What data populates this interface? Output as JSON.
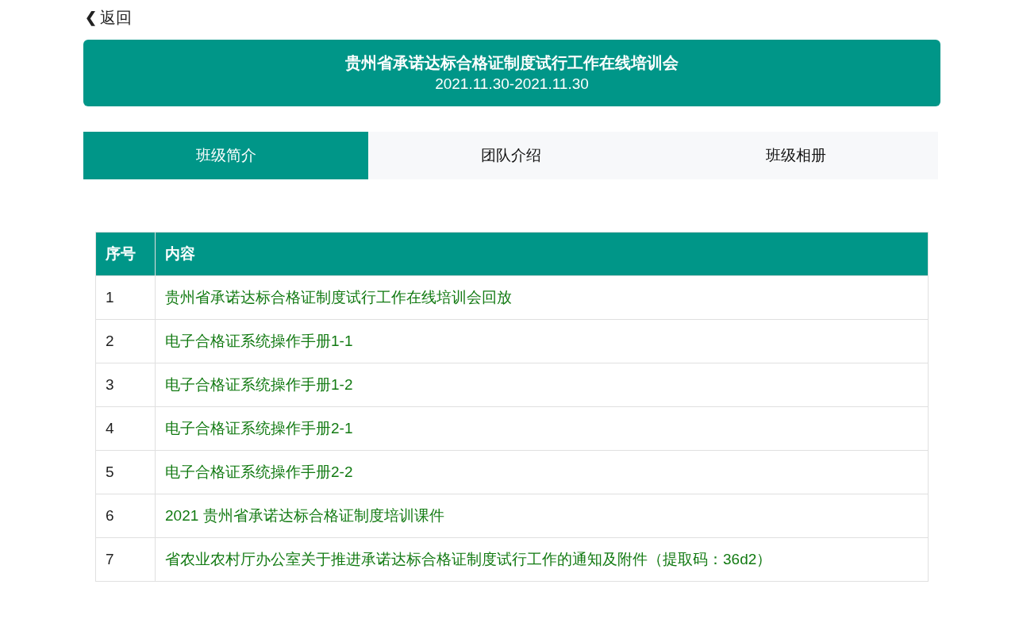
{
  "back": {
    "icon": "❮",
    "label": "返回"
  },
  "header": {
    "title": "贵州省承诺达标合格证制度试行工作在线培训会",
    "dates": "2021.11.30-2021.11.30"
  },
  "tabs": [
    {
      "label": "班级简介",
      "selected": true
    },
    {
      "label": "团队介绍",
      "selected": false
    },
    {
      "label": "班级相册",
      "selected": false
    }
  ],
  "table": {
    "columns": [
      "序号",
      "内容"
    ],
    "rows": [
      {
        "index": "1",
        "content": "贵州省承诺达标合格证制度试行工作在线培训会回放"
      },
      {
        "index": "2",
        "content": "电子合格证系统操作手册1-1"
      },
      {
        "index": "3",
        "content": "电子合格证系统操作手册1-2"
      },
      {
        "index": "4",
        "content": "电子合格证系统操作手册2-1"
      },
      {
        "index": "5",
        "content": "电子合格证系统操作手册2-2"
      },
      {
        "index": "6",
        "content": "2021 贵州省承诺达标合格证制度培训课件"
      },
      {
        "index": "7",
        "content": "省农业农村厅办公室关于推进承诺达标合格证制度试行工作的通知及附件（提取码：36d2）"
      }
    ]
  }
}
